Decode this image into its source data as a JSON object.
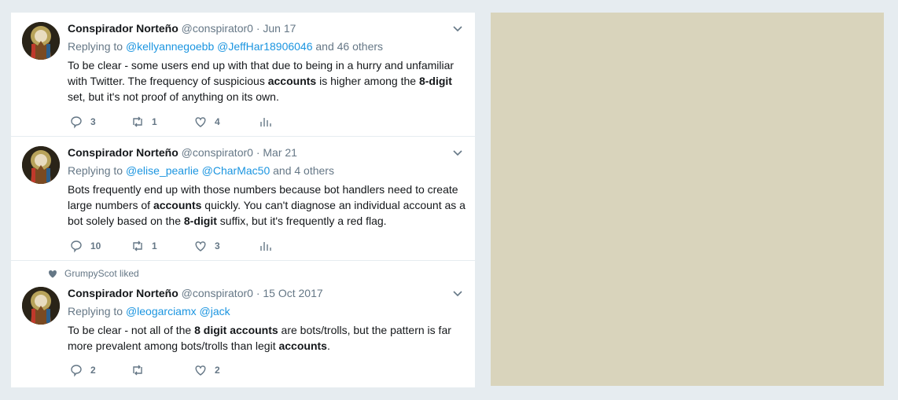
{
  "colors": {
    "page_background": "#e6ecf0",
    "side_panel": "#d9d4bc",
    "link": "#1b95e0",
    "muted_text": "#657786",
    "primary_text": "#14171a"
  },
  "icons": {
    "reply": "reply-icon",
    "retweet": "retweet-icon",
    "like": "heart-icon",
    "analytics": "analytics-icon",
    "caret": "chevron-down-icon"
  },
  "tweets": [
    {
      "name": "Conspirador Norteño",
      "handle": "@conspirator0",
      "separator": "·",
      "date": "Jun 17",
      "replying_prefix": "Replying to",
      "reply_handle_1": "@kellyannegoebb",
      "reply_handle_2": "@JeffHar18906046",
      "reply_suffix": "and 46 others",
      "text_1": "To be clear - some users end up with that due to being in a hurry and unfamiliar with Twitter. The frequency of suspicious ",
      "text_2": "accounts",
      "text_3": " is higher among the ",
      "text_4": "8-digit",
      "text_5": " set, but it's not proof of anything on its own.",
      "replies": "3",
      "retweets": "1",
      "likes": "4"
    },
    {
      "name": "Conspirador Norteño",
      "handle": "@conspirator0",
      "separator": "·",
      "date": "Mar 21",
      "replying_prefix": "Replying to",
      "reply_handle_1": "@elise_pearlie",
      "reply_handle_2": "@CharMac50",
      "reply_suffix": "and 4 others",
      "text_1": "Bots frequently end up with those numbers because bot handlers need to create large numbers of ",
      "text_2": "accounts",
      "text_3": " quickly. You can't diagnose an individual account as a bot solely based on the ",
      "text_4": "8-digit",
      "text_5": " suffix, but it's frequently a red flag.",
      "replies": "10",
      "retweets": "1",
      "likes": "3"
    },
    {
      "liked_by": "GrumpyScot liked",
      "name": "Conspirador Norteño",
      "handle": "@conspirator0",
      "separator": "·",
      "date": "15 Oct 2017",
      "replying_prefix": "Replying to",
      "reply_handle_1": "@leogarciamx",
      "reply_handle_2": "@jack",
      "text_1": "To be clear - not all of the ",
      "text_2": "8 digit accounts",
      "text_3": " are bots/trolls, but the pattern is far more prevalent among bots/trolls than legit ",
      "text_4": "accounts",
      "text_5": ".",
      "replies": "2",
      "retweets": "",
      "likes": "2"
    }
  ]
}
